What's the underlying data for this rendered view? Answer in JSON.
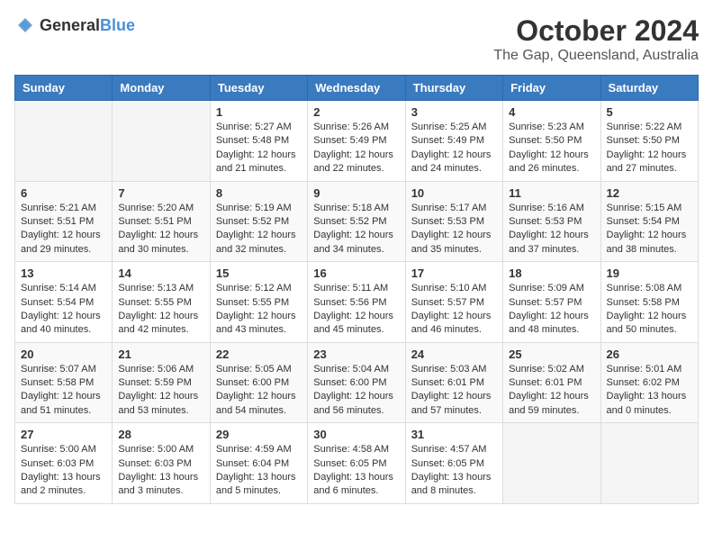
{
  "header": {
    "logo_general": "General",
    "logo_blue": "Blue",
    "month": "October 2024",
    "location": "The Gap, Queensland, Australia"
  },
  "columns": [
    "Sunday",
    "Monday",
    "Tuesday",
    "Wednesday",
    "Thursday",
    "Friday",
    "Saturday"
  ],
  "weeks": [
    [
      {
        "day": "",
        "info": ""
      },
      {
        "day": "",
        "info": ""
      },
      {
        "day": "1",
        "info": "Sunrise: 5:27 AM\nSunset: 5:48 PM\nDaylight: 12 hours and 21 minutes."
      },
      {
        "day": "2",
        "info": "Sunrise: 5:26 AM\nSunset: 5:49 PM\nDaylight: 12 hours and 22 minutes."
      },
      {
        "day": "3",
        "info": "Sunrise: 5:25 AM\nSunset: 5:49 PM\nDaylight: 12 hours and 24 minutes."
      },
      {
        "day": "4",
        "info": "Sunrise: 5:23 AM\nSunset: 5:50 PM\nDaylight: 12 hours and 26 minutes."
      },
      {
        "day": "5",
        "info": "Sunrise: 5:22 AM\nSunset: 5:50 PM\nDaylight: 12 hours and 27 minutes."
      }
    ],
    [
      {
        "day": "6",
        "info": "Sunrise: 5:21 AM\nSunset: 5:51 PM\nDaylight: 12 hours and 29 minutes."
      },
      {
        "day": "7",
        "info": "Sunrise: 5:20 AM\nSunset: 5:51 PM\nDaylight: 12 hours and 30 minutes."
      },
      {
        "day": "8",
        "info": "Sunrise: 5:19 AM\nSunset: 5:52 PM\nDaylight: 12 hours and 32 minutes."
      },
      {
        "day": "9",
        "info": "Sunrise: 5:18 AM\nSunset: 5:52 PM\nDaylight: 12 hours and 34 minutes."
      },
      {
        "day": "10",
        "info": "Sunrise: 5:17 AM\nSunset: 5:53 PM\nDaylight: 12 hours and 35 minutes."
      },
      {
        "day": "11",
        "info": "Sunrise: 5:16 AM\nSunset: 5:53 PM\nDaylight: 12 hours and 37 minutes."
      },
      {
        "day": "12",
        "info": "Sunrise: 5:15 AM\nSunset: 5:54 PM\nDaylight: 12 hours and 38 minutes."
      }
    ],
    [
      {
        "day": "13",
        "info": "Sunrise: 5:14 AM\nSunset: 5:54 PM\nDaylight: 12 hours and 40 minutes."
      },
      {
        "day": "14",
        "info": "Sunrise: 5:13 AM\nSunset: 5:55 PM\nDaylight: 12 hours and 42 minutes."
      },
      {
        "day": "15",
        "info": "Sunrise: 5:12 AM\nSunset: 5:55 PM\nDaylight: 12 hours and 43 minutes."
      },
      {
        "day": "16",
        "info": "Sunrise: 5:11 AM\nSunset: 5:56 PM\nDaylight: 12 hours and 45 minutes."
      },
      {
        "day": "17",
        "info": "Sunrise: 5:10 AM\nSunset: 5:57 PM\nDaylight: 12 hours and 46 minutes."
      },
      {
        "day": "18",
        "info": "Sunrise: 5:09 AM\nSunset: 5:57 PM\nDaylight: 12 hours and 48 minutes."
      },
      {
        "day": "19",
        "info": "Sunrise: 5:08 AM\nSunset: 5:58 PM\nDaylight: 12 hours and 50 minutes."
      }
    ],
    [
      {
        "day": "20",
        "info": "Sunrise: 5:07 AM\nSunset: 5:58 PM\nDaylight: 12 hours and 51 minutes."
      },
      {
        "day": "21",
        "info": "Sunrise: 5:06 AM\nSunset: 5:59 PM\nDaylight: 12 hours and 53 minutes."
      },
      {
        "day": "22",
        "info": "Sunrise: 5:05 AM\nSunset: 6:00 PM\nDaylight: 12 hours and 54 minutes."
      },
      {
        "day": "23",
        "info": "Sunrise: 5:04 AM\nSunset: 6:00 PM\nDaylight: 12 hours and 56 minutes."
      },
      {
        "day": "24",
        "info": "Sunrise: 5:03 AM\nSunset: 6:01 PM\nDaylight: 12 hours and 57 minutes."
      },
      {
        "day": "25",
        "info": "Sunrise: 5:02 AM\nSunset: 6:01 PM\nDaylight: 12 hours and 59 minutes."
      },
      {
        "day": "26",
        "info": "Sunrise: 5:01 AM\nSunset: 6:02 PM\nDaylight: 13 hours and 0 minutes."
      }
    ],
    [
      {
        "day": "27",
        "info": "Sunrise: 5:00 AM\nSunset: 6:03 PM\nDaylight: 13 hours and 2 minutes."
      },
      {
        "day": "28",
        "info": "Sunrise: 5:00 AM\nSunset: 6:03 PM\nDaylight: 13 hours and 3 minutes."
      },
      {
        "day": "29",
        "info": "Sunrise: 4:59 AM\nSunset: 6:04 PM\nDaylight: 13 hours and 5 minutes."
      },
      {
        "day": "30",
        "info": "Sunrise: 4:58 AM\nSunset: 6:05 PM\nDaylight: 13 hours and 6 minutes."
      },
      {
        "day": "31",
        "info": "Sunrise: 4:57 AM\nSunset: 6:05 PM\nDaylight: 13 hours and 8 minutes."
      },
      {
        "day": "",
        "info": ""
      },
      {
        "day": "",
        "info": ""
      }
    ]
  ]
}
